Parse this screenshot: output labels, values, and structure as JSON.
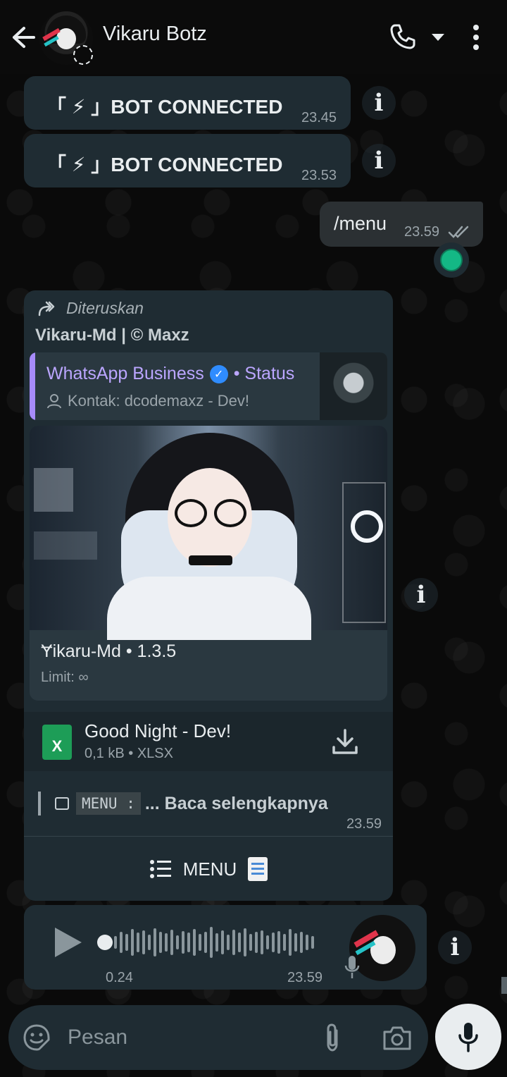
{
  "header": {
    "contact_name": "Vikaru Botz",
    "icons": [
      "back-arrow-icon",
      "call-icon",
      "chevron-down-icon",
      "more-vertical-icon"
    ]
  },
  "messages": {
    "system_1": {
      "text": "「 ⚡ 」BOT CONNECTED",
      "time": "23.45"
    },
    "system_2": {
      "text": "「 ⚡ 」BOT CONNECTED",
      "time": "23.53"
    },
    "outgoing": {
      "text": "/menu",
      "time": "23.59"
    },
    "forwarded": {
      "forward_label": "Diteruskan",
      "sender": "Vikaru-Md | © Maxz",
      "quote": {
        "title": "WhatsApp Business",
        "title_suffix": "• Status",
        "subtitle": "Kontak: dcodemaxz - Dev!"
      },
      "preview": {
        "title": "Ɏikaru-Md • 1.3.5",
        "subtitle": "Limit: ∞"
      },
      "document": {
        "name": "Good Night - Dev!",
        "meta": "0,1 kB • XLSX",
        "icon_label": "X"
      },
      "menu_code": "MENU  :",
      "read_more": "... Baca selengkapnya",
      "time": "23.59",
      "button_label": "MENU"
    },
    "voice": {
      "duration": "0.24",
      "time": "23.59"
    }
  },
  "info_badge": "i",
  "composer": {
    "placeholder": "Pesan"
  },
  "colors": {
    "accent_purple": "#a78bfa",
    "verified_blue": "#2f8cff",
    "xlsx_green": "#1d9d57",
    "reaction_green": "#14b885"
  }
}
